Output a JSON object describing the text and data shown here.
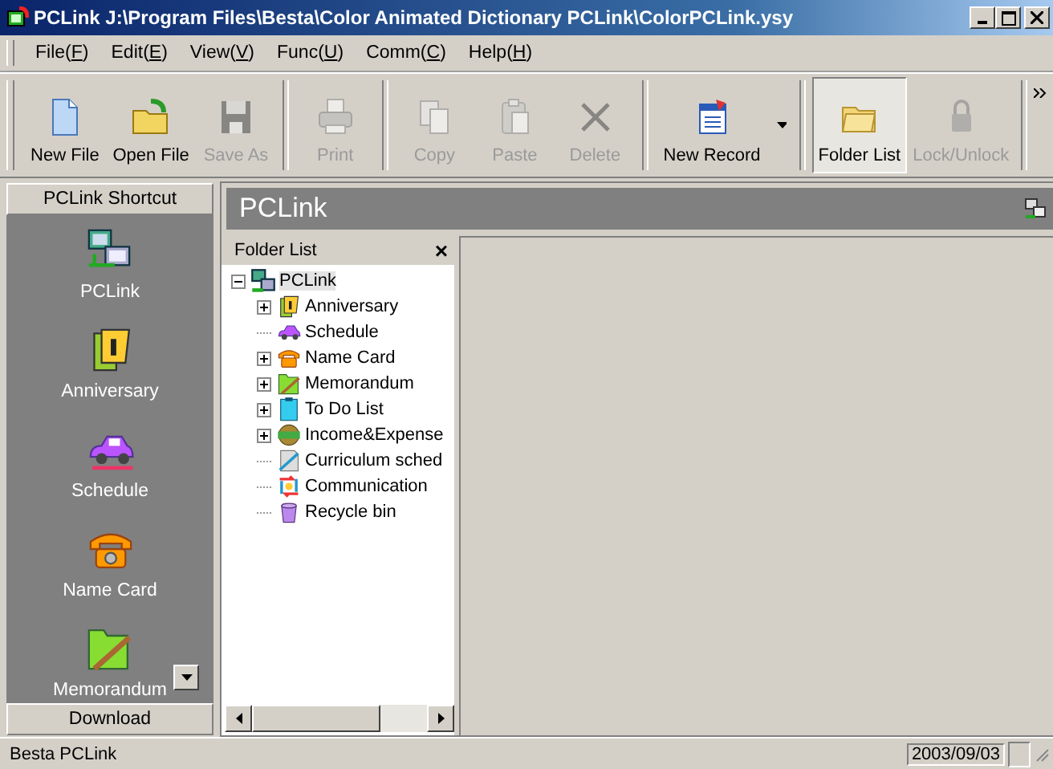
{
  "window": {
    "title": "PCLink J:\\Program Files\\Besta\\Color Animated Dictionary PCLink\\ColorPCLink.ysy"
  },
  "menu": [
    {
      "label": "File(F)"
    },
    {
      "label": "Edit(E)"
    },
    {
      "label": "View(V)"
    },
    {
      "label": "Func(U)"
    },
    {
      "label": "Comm(C)"
    },
    {
      "label": "Help(H)"
    }
  ],
  "toolbar": [
    {
      "label": "New File",
      "kind": "document",
      "disabled": false,
      "selected": false
    },
    {
      "label": "Open File",
      "kind": "folder",
      "disabled": false,
      "selected": false
    },
    {
      "label": "Save As",
      "kind": "disk",
      "disabled": true,
      "selected": false
    },
    {
      "label": "Print",
      "kind": "printer",
      "disabled": true,
      "selected": false
    },
    {
      "label": "Copy",
      "kind": "copy",
      "disabled": true,
      "selected": false
    },
    {
      "label": "Paste",
      "kind": "paste",
      "disabled": true,
      "selected": false
    },
    {
      "label": "Delete",
      "kind": "delete",
      "disabled": true,
      "selected": false
    },
    {
      "label": "New Record",
      "kind": "record",
      "disabled": false,
      "selected": false
    },
    {
      "label": "Folder List",
      "kind": "folders",
      "disabled": false,
      "selected": true
    },
    {
      "label": "Lock/Unlock",
      "kind": "lock",
      "disabled": true,
      "selected": false
    }
  ],
  "sidebar": {
    "title": "PCLink Shortcut",
    "items": [
      {
        "label": "PCLink",
        "kind": "computer"
      },
      {
        "label": "Anniversary",
        "kind": "calendar"
      },
      {
        "label": "Schedule",
        "kind": "car"
      },
      {
        "label": "Name Card",
        "kind": "phone"
      },
      {
        "label": "Memorandum",
        "kind": "memo"
      }
    ],
    "footer": "Download"
  },
  "header": {
    "title": "PCLink"
  },
  "folder_list": {
    "title": "Folder List",
    "close": "×",
    "root": {
      "label": "PCLink",
      "expanded": true,
      "selected": true,
      "children": [
        {
          "label": "Anniversary",
          "kind": "calendar",
          "collapsed": true
        },
        {
          "label": "Schedule",
          "kind": "car",
          "collapsed": false
        },
        {
          "label": "Name Card",
          "kind": "phone",
          "collapsed": true
        },
        {
          "label": "Memorandum",
          "kind": "memo",
          "collapsed": true
        },
        {
          "label": "To Do List",
          "kind": "todo",
          "collapsed": true
        },
        {
          "label": "Income&Expense",
          "kind": "money",
          "collapsed": true
        },
        {
          "label": "Curriculum sched",
          "kind": "ruler",
          "collapsed": false
        },
        {
          "label": "Communication",
          "kind": "exchange",
          "collapsed": false
        },
        {
          "label": "Recycle bin",
          "kind": "bin",
          "collapsed": false
        }
      ]
    }
  },
  "status_bar": {
    "text": "Besta PCLink",
    "date": "2003/09/03"
  }
}
